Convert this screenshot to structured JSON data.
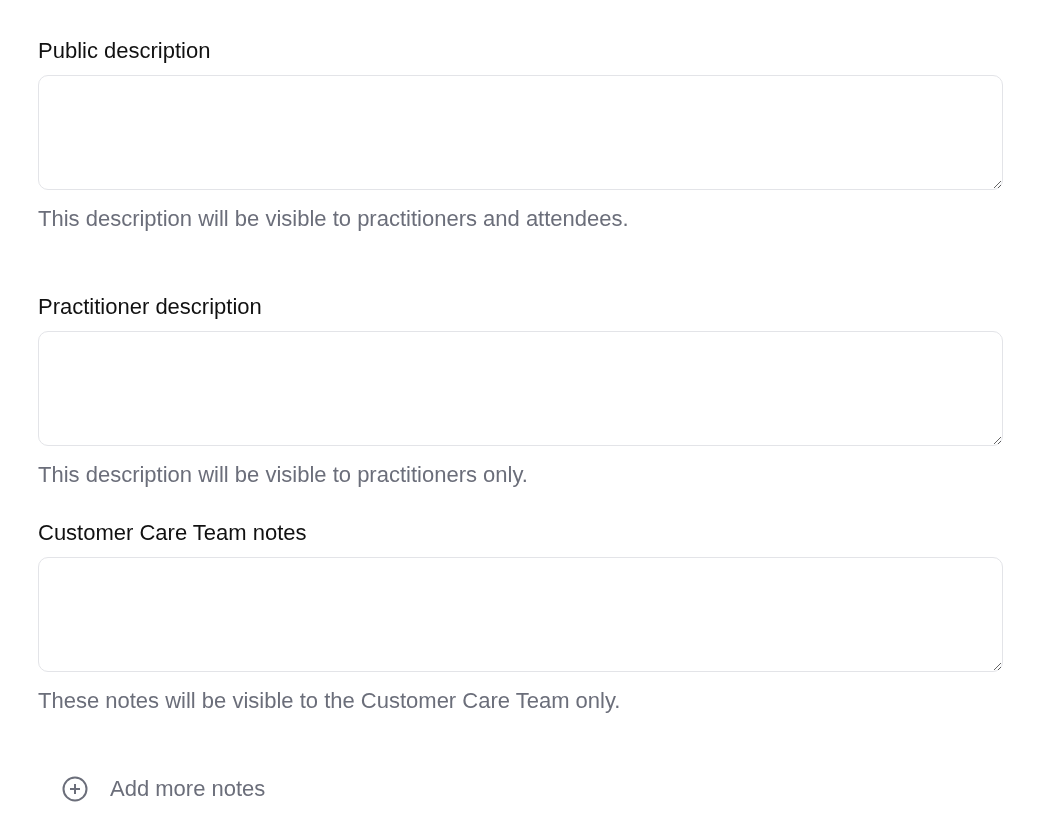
{
  "fields": [
    {
      "label": "Public description",
      "helper": "This description will be visible to practitioners and attendees."
    },
    {
      "label": "Practitioner description",
      "helper": "This description will be visible to practitioners only."
    },
    {
      "label": "Customer Care Team notes",
      "helper": "These notes will be visible to the Customer Care Team only."
    }
  ],
  "add_button": {
    "label": "Add more notes"
  }
}
